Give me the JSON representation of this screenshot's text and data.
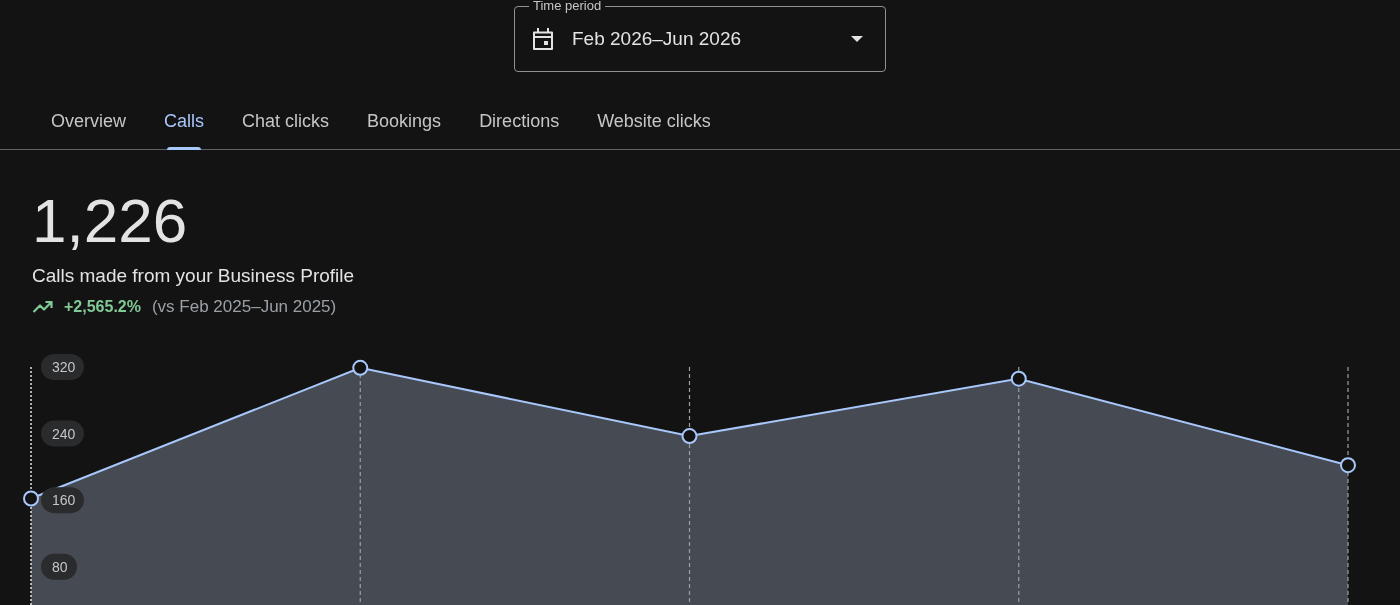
{
  "time_period": {
    "label": "Time period",
    "value": "Feb 2026–Jun 2026"
  },
  "tabs": [
    {
      "label": "Overview",
      "selected": false
    },
    {
      "label": "Calls",
      "selected": true
    },
    {
      "label": "Chat clicks",
      "selected": false
    },
    {
      "label": "Bookings",
      "selected": false
    },
    {
      "label": "Directions",
      "selected": false
    },
    {
      "label": "Website clicks",
      "selected": false
    }
  ],
  "summary": {
    "total": "1,226",
    "description": "Calls made from your Business Profile",
    "increase": true,
    "change": "+2,565.2%",
    "comparison": "(vs Feb 2025–Jun 2025)"
  },
  "chart_data": {
    "type": "area",
    "categories": [
      null,
      null,
      null,
      null,
      null
    ],
    "series": [
      {
        "color": "#a8c7fa",
        "values": [
          162,
          319,
          237,
          306,
          202
        ]
      }
    ],
    "ylim": [
      34,
      320
    ],
    "yticks": [
      {
        "value": 80,
        "label": "80"
      },
      {
        "value": 160,
        "label": "160"
      },
      {
        "value": 240,
        "label": "240"
      },
      {
        "value": 320,
        "label": "320"
      }
    ],
    "grid": true
  }
}
